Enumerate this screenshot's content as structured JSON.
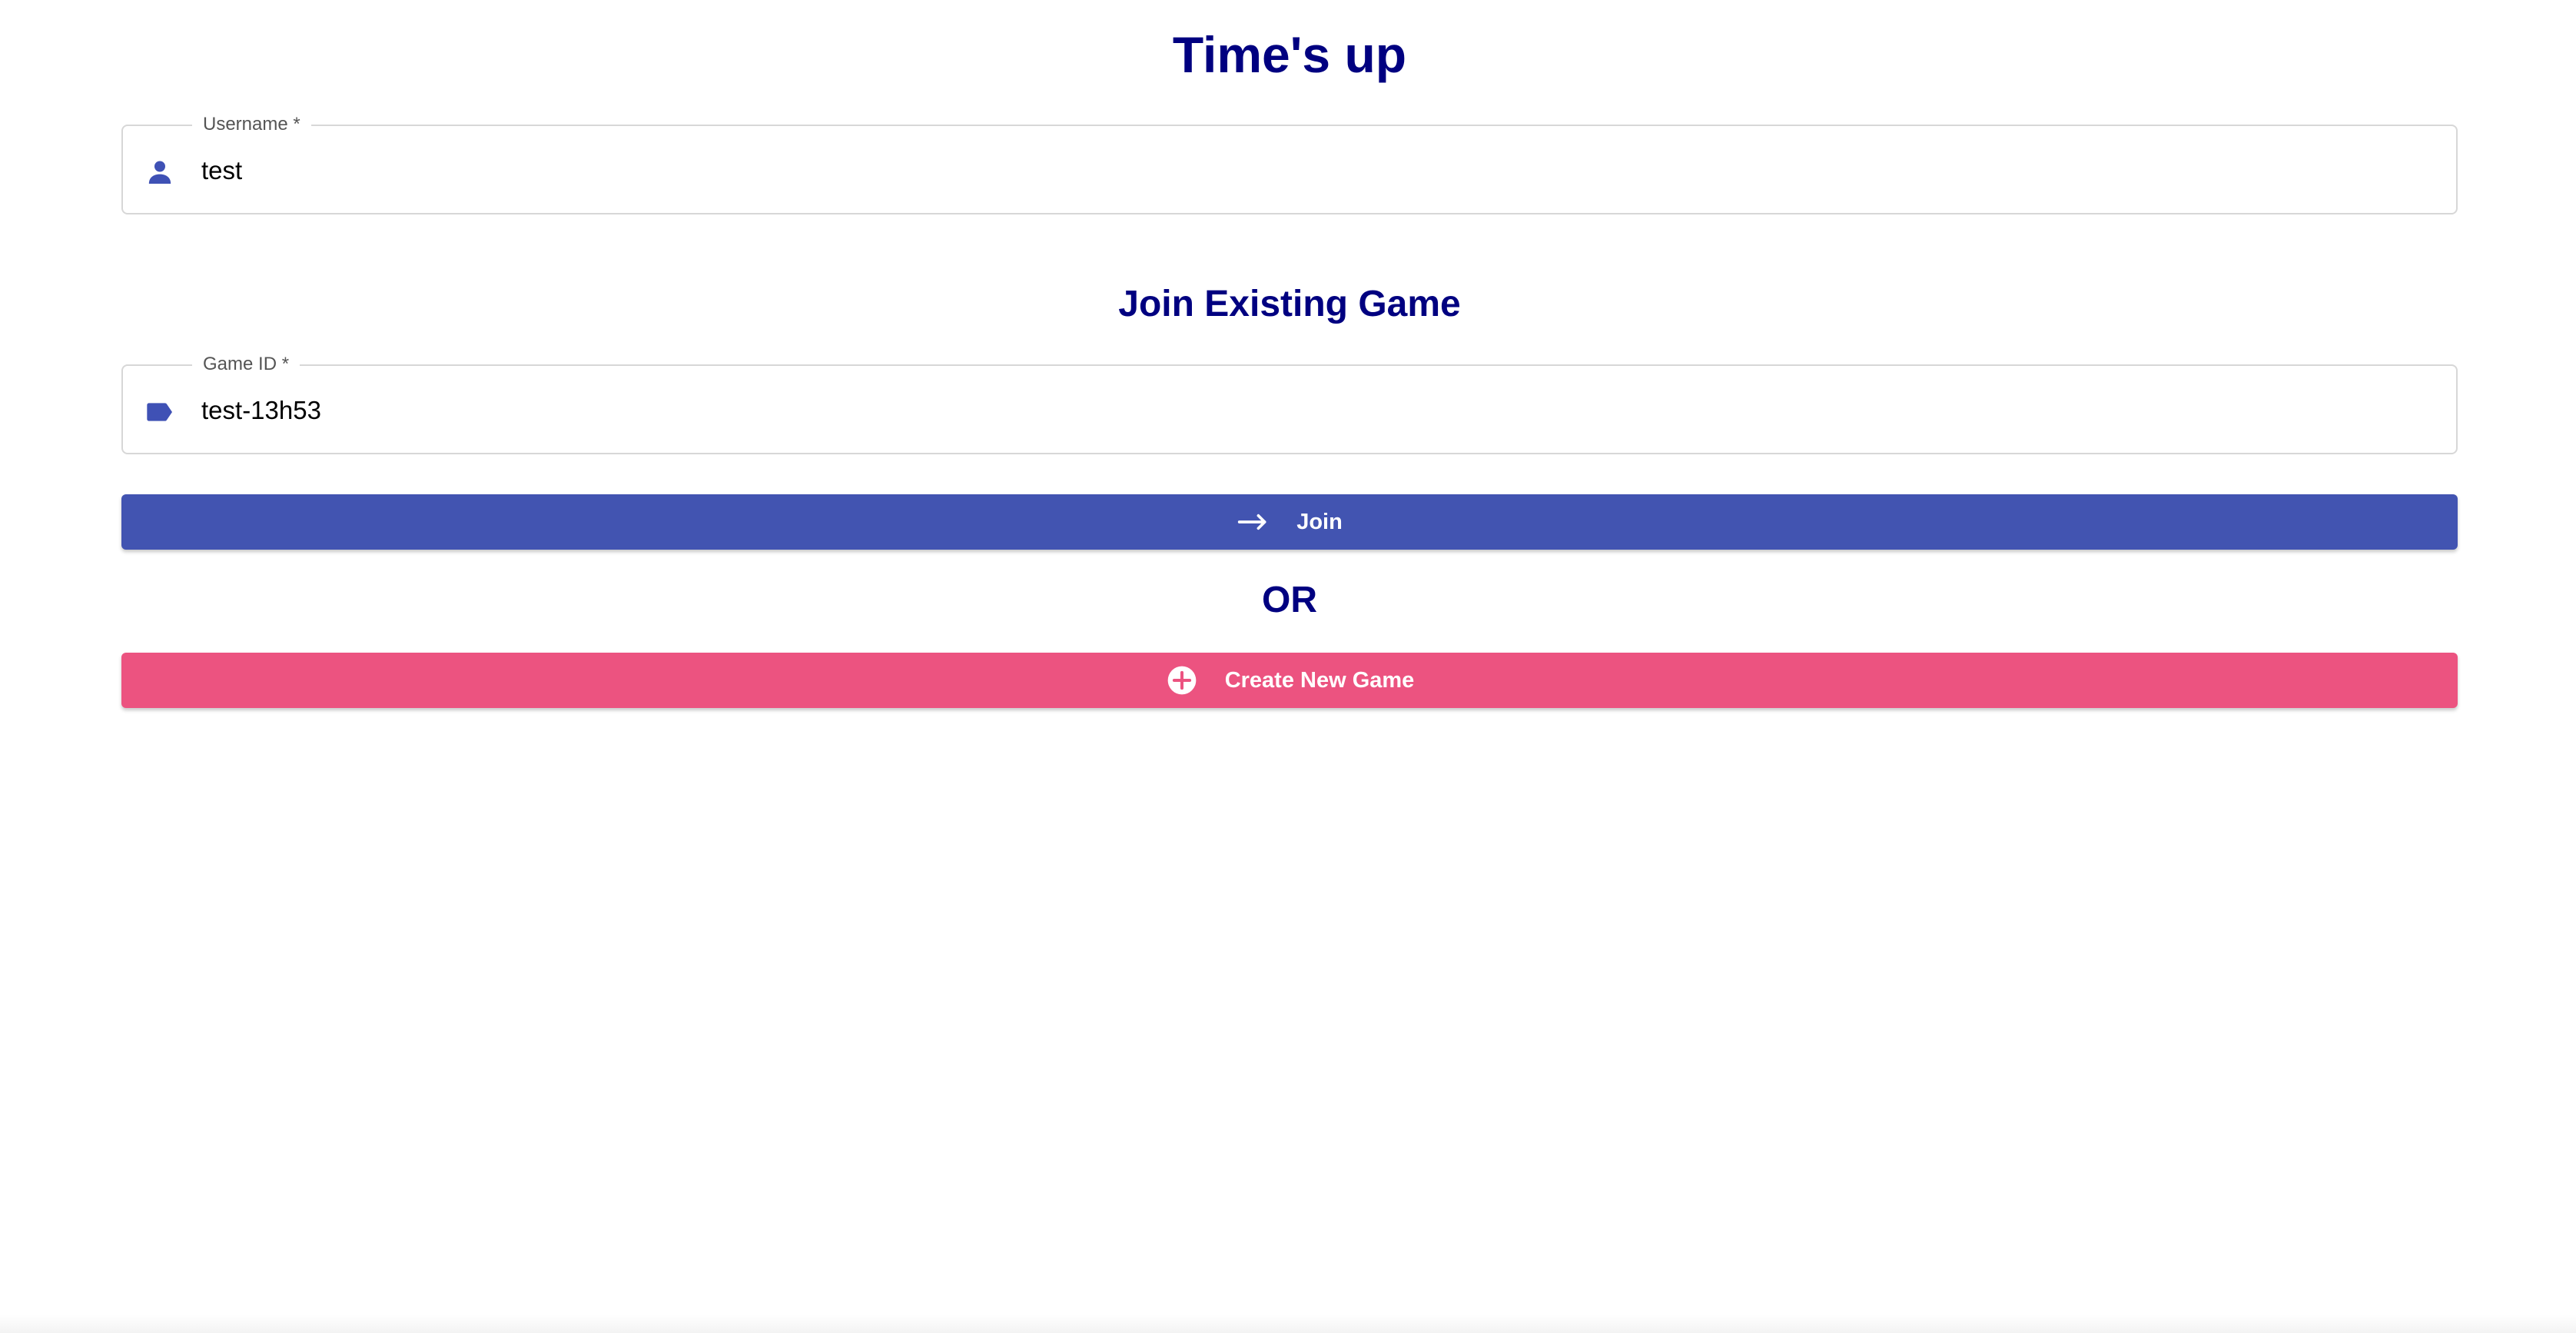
{
  "page": {
    "title": "Time's up"
  },
  "username_field": {
    "label": "Username *",
    "value": "test",
    "icon": "person-icon"
  },
  "join_section": {
    "title": "Join Existing Game",
    "game_id_field": {
      "label": "Game ID *",
      "value": "test-13h53",
      "icon": "label-tag-icon"
    },
    "join_button": {
      "label": "Join",
      "icon": "arrow-right-icon"
    }
  },
  "separator": {
    "text": "OR"
  },
  "create_button": {
    "label": "Create New Game",
    "icon": "add-circle-icon"
  },
  "colors": {
    "heading": "#000080",
    "primary": "#4254b1",
    "secondary": "#ec5380",
    "icon": "#3f51b5"
  }
}
